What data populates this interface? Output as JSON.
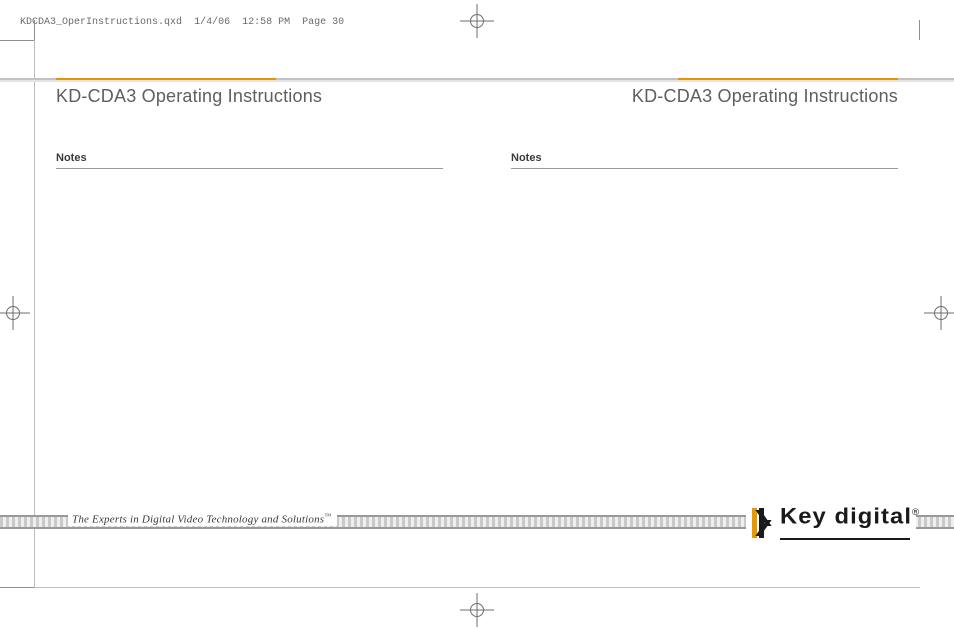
{
  "slug": {
    "file": "KDCDA3_OperInstructions.qxd",
    "date": "1/4/06",
    "time": "12:58 PM",
    "page_label": "Page",
    "page_number": 30
  },
  "pages": {
    "left": {
      "title": "KD-CDA3 Operating Instructions",
      "section": "Notes"
    },
    "right": {
      "title": "KD-CDA3 Operating Instructions",
      "section": "Notes"
    }
  },
  "footer": {
    "tagline": "The Experts in Digital Video Technology and Solutions",
    "tagline_mark": "™"
  },
  "logo": {
    "brand": "Key digital",
    "mark": "®"
  },
  "colors": {
    "accent": "#e49500",
    "rule": "#c2c2c2",
    "text": "#4a4a4a"
  }
}
